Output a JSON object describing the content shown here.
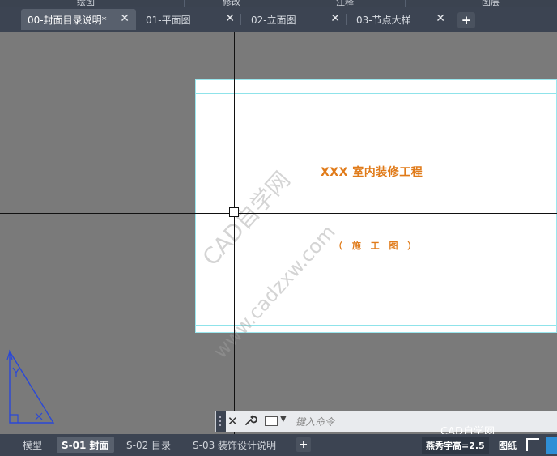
{
  "ribbon": {
    "panels": [
      "绘图",
      "修改",
      "注释",
      "图层"
    ]
  },
  "file_tabs": [
    {
      "label": "00-封面目录说明*",
      "active": true
    },
    {
      "label": "01-平面图",
      "active": false
    },
    {
      "label": "02-立面图",
      "active": false
    },
    {
      "label": "03-节点大样",
      "active": false
    }
  ],
  "new_tab_label": "+",
  "close_glyph": "✕",
  "drawing": {
    "title": "XXX 室内装修工程",
    "subtitle": "（ 施 工 图 ）"
  },
  "watermark": {
    "line1": "CAD自学网",
    "line2": "www.cadzxw.com"
  },
  "command_line": {
    "close_glyph": "✕",
    "wrench_icon": "wrench-icon",
    "placeholder": "键入命令"
  },
  "brand_label": "CAD自学网",
  "layout_tabs": [
    {
      "label": "模型",
      "active": false
    },
    {
      "label": "S-01 封面",
      "active": true
    },
    {
      "label": "S-02 目录",
      "active": false
    },
    {
      "label": "S-03 装饰设计说明",
      "active": false
    }
  ],
  "layout_add": "+",
  "status": {
    "text_style": "燕秀字高=2.5",
    "space": "图纸"
  },
  "colors": {
    "title_text": "#e07b1a",
    "paper_border": "#9ae7ee",
    "ucs": "#2a48d8",
    "tab_bar": "#3c4452"
  }
}
